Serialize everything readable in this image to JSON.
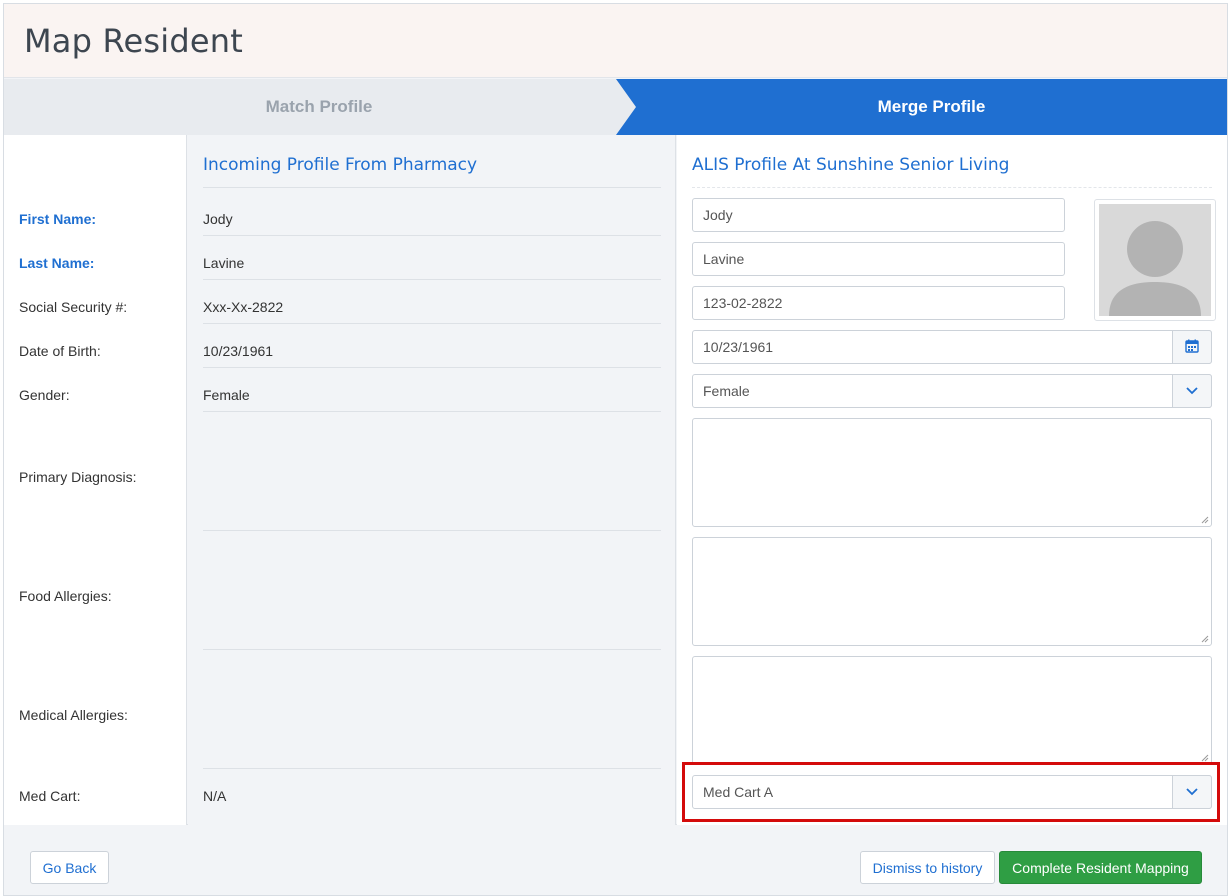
{
  "page": {
    "title": "Map Resident"
  },
  "steps": {
    "match": "Match Profile",
    "merge": "Merge Profile"
  },
  "labels": {
    "first_name": "First Name:",
    "last_name": "Last Name:",
    "ssn": "Social Security #:",
    "dob": "Date of Birth:",
    "gender": "Gender:",
    "primary_diagnosis": "Primary Diagnosis:",
    "food_allergies": "Food Allergies:",
    "medical_allergies": "Medical Allergies:",
    "med_cart": "Med Cart:"
  },
  "pharmacy": {
    "title": "Incoming Profile From Pharmacy",
    "first_name": "Jody",
    "last_name": "Lavine",
    "ssn": "Xxx-Xx-2822",
    "dob": "10/23/1961",
    "gender": "Female",
    "med_cart": "N/A"
  },
  "alis": {
    "title": "ALIS Profile At Sunshine Senior Living",
    "first_name": "Jody",
    "last_name": "Lavine",
    "ssn": "123-02-2822",
    "dob": "10/23/1961",
    "gender": "Female",
    "med_cart": "Med Cart A"
  },
  "buttons": {
    "go_back": "Go Back",
    "dismiss": "Dismiss to history",
    "complete": "Complete Resident Mapping"
  },
  "icons": {
    "calendar": "calendar-icon",
    "chevron": "chevron-down-icon",
    "avatar": "avatar-placeholder"
  },
  "colors": {
    "accent": "#1f6fd1",
    "success": "#2f9e44",
    "highlight": "#d40b0b"
  }
}
